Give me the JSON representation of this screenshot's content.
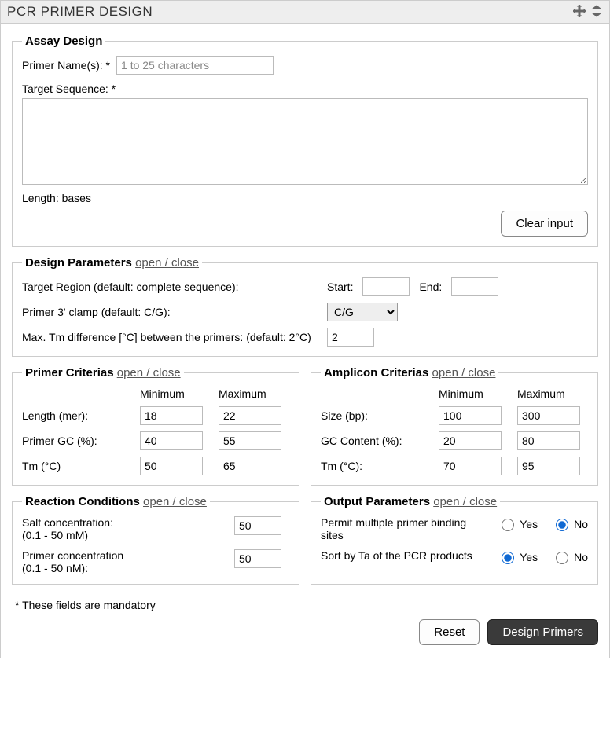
{
  "panel": {
    "title": "PCR PRIMER DESIGN"
  },
  "assay": {
    "legend": "Assay Design",
    "primerNameLabel": "Primer Name(s): *",
    "primerNamePlaceholder": "1 to 25 characters",
    "primerNameValue": "",
    "targetSeqLabel": "Target Sequence: *",
    "targetSeqValue": "",
    "lengthLabel": "Length: bases",
    "clearBtn": "Clear input"
  },
  "designParams": {
    "legend": "Design Parameters",
    "toggle": "open / close",
    "targetRegionLabel": "Target Region (default: complete sequence):",
    "startLabel": "Start:",
    "startValue": "",
    "endLabel": "End:",
    "endValue": "",
    "clampLabel": "Primer 3' clamp (default: C/G):",
    "clampValue": "C/G",
    "maxTmDiffLabel": "Max. Tm difference [°C] between the primers: (default: 2°C)",
    "maxTmDiffValue": "2"
  },
  "primerCriteria": {
    "legend": "Primer Criterias",
    "toggle": "open / close",
    "minHdr": "Minimum",
    "maxHdr": "Maximum",
    "lengthLabel": "Length (mer):",
    "lengthMin": "18",
    "lengthMax": "22",
    "gcLabel": "Primer GC (%):",
    "gcMin": "40",
    "gcMax": "55",
    "tmLabel": "Tm (°C)",
    "tmMin": "50",
    "tmMax": "65"
  },
  "ampliconCriteria": {
    "legend": "Amplicon Criterias",
    "toggle": "open / close",
    "minHdr": "Minimum",
    "maxHdr": "Maximum",
    "sizeLabel": "Size (bp):",
    "sizeMin": "100",
    "sizeMax": "300",
    "gcLabel": "GC Content (%):",
    "gcMin": "20",
    "gcMax": "80",
    "tmLabel": "Tm (°C):",
    "tmMin": "70",
    "tmMax": "95"
  },
  "reaction": {
    "legend": "Reaction Conditions",
    "toggle": "open / close",
    "saltLabel": "Salt concentration:\n(0.1 - 50 mM)",
    "saltValue": "50",
    "primerLabel": "Primer concentration\n(0.1 - 50 nM):",
    "primerValue": "50"
  },
  "output": {
    "legend": "Output Parameters",
    "toggle": "open / close",
    "multiLabel": "Permit multiple primer binding sites",
    "sortLabel": "Sort by Ta of the PCR products",
    "yes": "Yes",
    "no": "No",
    "multiValue": "No",
    "sortValue": "Yes"
  },
  "footer": {
    "note": "* These fields are mandatory",
    "reset": "Reset",
    "submit": "Design Primers"
  }
}
